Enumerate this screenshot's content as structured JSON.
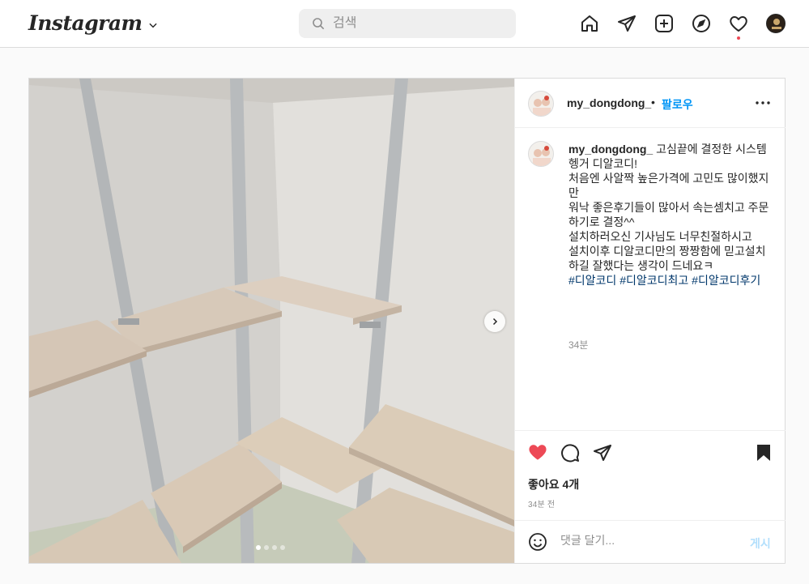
{
  "nav": {
    "logo": "Instagram",
    "search_placeholder": "검색",
    "icons": [
      "home-icon",
      "direct-icon",
      "new-post-icon",
      "explore-icon",
      "activity-icon",
      "profile-avatar"
    ],
    "notification_color": "#ed4956"
  },
  "post": {
    "username": "my_dongdong_",
    "follow_label": "팔로우",
    "separator": "•",
    "caption_lines": [
      "고심끝에 결정한 시스템헹거 디알코디!",
      "처음엔 사알짝 높은가격에 고민도 많이했지만",
      "워낙 좋은후기들이 많아서 속는셈치고 주문하기로 결정^^",
      "설치하러오신 기사님도 너무친절하시고",
      "설치이후 디알코디만의 짱짱함에 믿고설치하길 잘했다는 생각이 드네요ㅋ"
    ],
    "hashtags": [
      "#디알코디",
      "#디알코디최고",
      "#디알코디후기"
    ],
    "caption_time": "34분",
    "likes": "좋아요 4개",
    "post_time": "34분 전",
    "comment_placeholder": "댓글 달기...",
    "post_button": "게시",
    "carousel": {
      "total": 4,
      "current": 1
    },
    "liked": true,
    "like_color": "#ed4956",
    "link_color": "#0095f6",
    "hashtag_color": "#00376b"
  }
}
